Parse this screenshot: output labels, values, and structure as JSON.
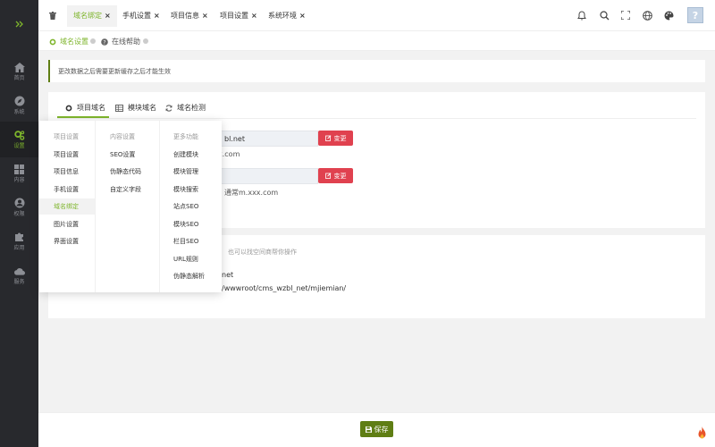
{
  "sidebar": {
    "toggle_icon": "double-chevron-right-icon",
    "items": [
      {
        "label": "首页",
        "icon": "home-icon"
      },
      {
        "label": "系统",
        "icon": "compass-icon"
      },
      {
        "label": "设置",
        "icon": "gears-icon",
        "active": true
      },
      {
        "label": "内容",
        "icon": "grid-icon"
      },
      {
        "label": "权限",
        "icon": "user-icon"
      },
      {
        "label": "应用",
        "icon": "puzzle-icon"
      },
      {
        "label": "服务",
        "icon": "cloud-icon"
      }
    ]
  },
  "topbar": {
    "home_icon": "trash-icon",
    "tabs": [
      {
        "label": "域名绑定",
        "active": true,
        "close": "×"
      },
      {
        "label": "手机设置",
        "close": "×"
      },
      {
        "label": "项目信息",
        "close": "×"
      },
      {
        "label": "项目设置",
        "close": "×"
      },
      {
        "label": "系统环境",
        "close": "×"
      }
    ],
    "right_icons": [
      "bell-icon",
      "search-icon",
      "fullscreen-icon",
      "globe-icon",
      "palette-icon"
    ],
    "avatar_text": "?"
  },
  "breadcrumb": {
    "items": [
      {
        "label": "域名设置",
        "icon": "gear-icon"
      },
      {
        "label": "在线帮助",
        "icon": "help-icon"
      }
    ]
  },
  "alert": {
    "text": "更改数据之后需要更新缓存之后才能生效"
  },
  "subtabs": [
    {
      "label": "项目域名",
      "icon": "gear-icon",
      "active": true
    },
    {
      "label": "模块域名",
      "icon": "table-icon"
    },
    {
      "label": "域名检测",
      "icon": "refresh-icon"
    }
  ],
  "fields": {
    "pc_value": "bl.net",
    "pc_hint": "x.com",
    "pc_button": "变更",
    "mobile_value": "",
    "mobile_hint": "通常m.xxx.com",
    "mobile_button": "变更",
    "note": "也可以找空间商帮你操作",
    "root_domain": "net",
    "root_path": "/wwwroot/cms_wzbl_net/mjiemian/"
  },
  "popup": {
    "columns": [
      {
        "header": "项目设置",
        "items": [
          "项目设置",
          "项目信息",
          "手机设置",
          "域名绑定",
          "图片设置",
          "界面设置"
        ],
        "active_index": 3
      },
      {
        "header": "内容设置",
        "items": [
          "SEO设置",
          "伪静态代码",
          "自定义字段"
        ]
      },
      {
        "header": "更多功能",
        "items": [
          "创建模块",
          "模块管理",
          "模块搜索",
          "站点SEO",
          "模块SEO",
          "栏目SEO",
          "URL规则",
          "伪静态解析"
        ]
      }
    ]
  },
  "footer": {
    "save_label": "保存",
    "save_icon": "save-icon"
  },
  "colors": {
    "accent": "#7eb52c",
    "dark_green": "#5f7e14",
    "danger": "#e0414f",
    "sidebar": "#28292d"
  }
}
